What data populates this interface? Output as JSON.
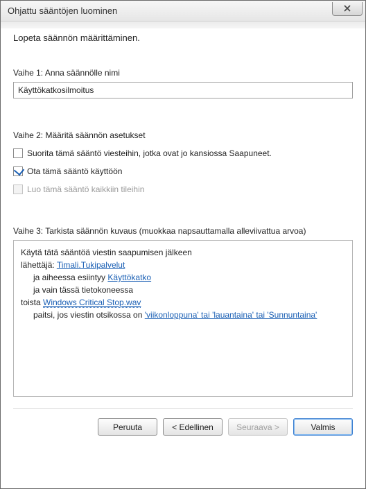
{
  "window_title": "Ohjattu sääntöjen luominen",
  "heading": "Lopeta säännön määrittäminen.",
  "step1": {
    "label": "Vaihe 1: Anna säännölle nimi",
    "value": "Käyttökatkosilmoitus"
  },
  "step2": {
    "label": "Vaihe 2: Määritä säännön asetukset",
    "cb_run_existing": {
      "label": "Suorita tämä sääntö viesteihin, jotka ovat jo kansiossa Saapuneet.",
      "checked": false,
      "enabled": true
    },
    "cb_enable": {
      "label": "Ota tämä sääntö käyttöön",
      "checked": true,
      "enabled": true
    },
    "cb_all_accounts": {
      "label": "Luo tämä sääntö kaikkiin tileihin",
      "checked": false,
      "enabled": false
    }
  },
  "step3": {
    "label": "Vaihe 3: Tarkista säännön kuvaus (muokkaa napsauttamalla alleviivattua arvoa)",
    "line1": "Käytä tätä sääntöä viestin saapumisen jälkeen",
    "sender_prefix": "lähettäjä: ",
    "sender_link": "Timali.Tukipalvelut",
    "subject_prefix": "ja aiheessa esiintyy ",
    "subject_link": "Käyttökatko",
    "only_computer": "ja vain tässä tietokoneessa",
    "play_prefix": "toista ",
    "play_link": "Windows Critical Stop.wav",
    "except_prefix": "paitsi, jos viestin otsikossa on ",
    "except_link": "'viikonloppuna' tai 'lauantaina' tai 'Sunnuntaina'"
  },
  "buttons": {
    "cancel": "Peruuta",
    "back": "< Edellinen",
    "next": "Seuraava >",
    "finish": "Valmis"
  }
}
